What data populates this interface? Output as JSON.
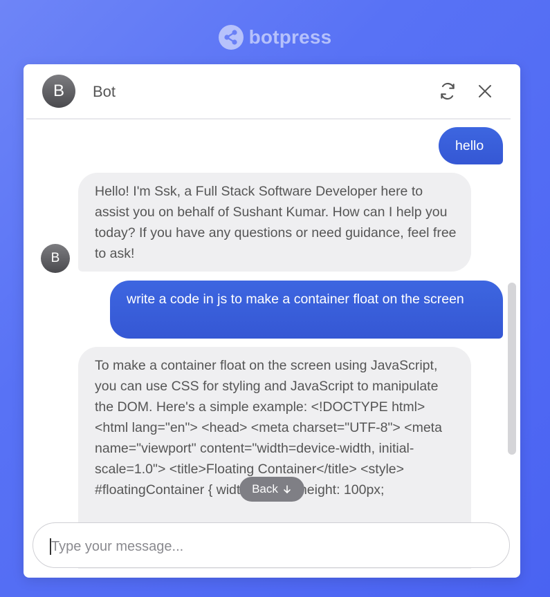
{
  "brand": {
    "name": "botpress",
    "icon": "share-icon"
  },
  "header": {
    "avatar_letter": "B",
    "title": "Bot",
    "refresh_icon": "refresh-icon",
    "close_icon": "close-icon"
  },
  "messages": [
    {
      "role": "user",
      "text": "hello"
    },
    {
      "role": "bot",
      "text": "Hello! I'm Ssk, a Full Stack Software Developer here to assist you on behalf of Sushant Kumar. How can I help you today? If you have any questions or need guidance, feel free to ask!"
    },
    {
      "role": "user",
      "text": "write a code in js to make a container float on the screen"
    },
    {
      "role": "bot",
      "text": "To make a container float on the screen using JavaScript, you can use CSS for styling and JavaScript to manipulate the DOM. Here's a simple example: <!DOCTYPE html> <html lang=\"en\"> <head> <meta charset=\"UTF-8\"> <meta name=\"viewport\" content=\"width=device-width, initial-scale=1.0\"> <title>Floating Container</title> <style> #floatingContainer { width: 200px; height: 100px;"
    }
  ],
  "bot_avatar_letter": "B",
  "back_button": {
    "label": "Back",
    "icon": "arrow-down-icon"
  },
  "composer": {
    "placeholder": "Type your message...",
    "value": ""
  },
  "colors": {
    "background": "#5872f5",
    "user_bubble": "#3a5fdc",
    "bot_bubble": "#efeff1"
  }
}
